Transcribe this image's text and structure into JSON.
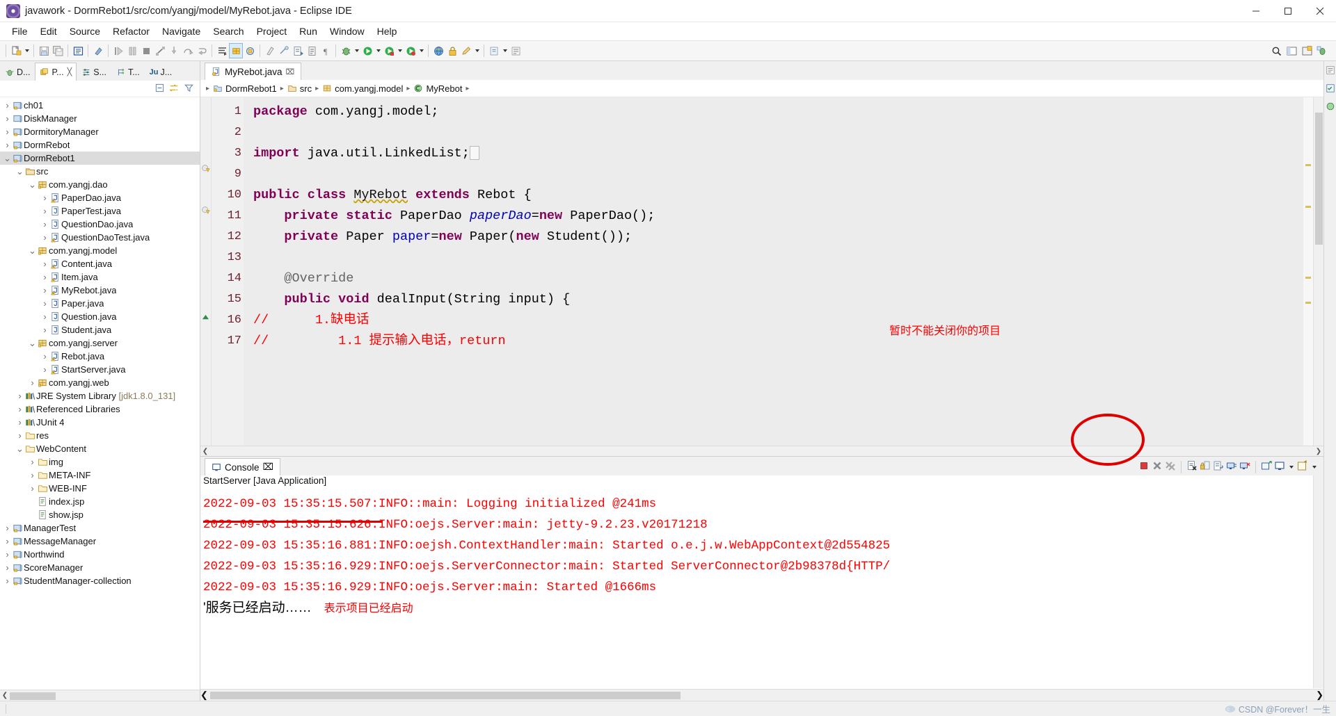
{
  "window": {
    "title": "javawork - DormRebot1/src/com/yangj/model/MyRebot.java - Eclipse IDE",
    "minimize": "─",
    "maximize": "☐",
    "close": "✕"
  },
  "menubar": [
    "File",
    "Edit",
    "Source",
    "Refactor",
    "Navigate",
    "Search",
    "Project",
    "Run",
    "Window",
    "Help"
  ],
  "explorer": {
    "tabs": [
      {
        "label": "D...",
        "active": false
      },
      {
        "label": "P...",
        "active": true
      },
      {
        "label": "S...",
        "active": false
      },
      {
        "label": "T...",
        "active": false
      },
      {
        "label": "J...",
        "active": false
      }
    ],
    "tree": [
      {
        "indent": 0,
        "arrow": "›",
        "icon": "project",
        "label": "ch01"
      },
      {
        "indent": 0,
        "arrow": "›",
        "icon": "project-plain",
        "label": "DiskManager"
      },
      {
        "indent": 0,
        "arrow": "›",
        "icon": "project",
        "label": "DormitoryManager"
      },
      {
        "indent": 0,
        "arrow": "›",
        "icon": "project",
        "label": "DormRebot"
      },
      {
        "indent": 0,
        "arrow": "⌄",
        "icon": "project",
        "label": "DormRebot1",
        "selected": true
      },
      {
        "indent": 1,
        "arrow": "⌄",
        "icon": "source-folder",
        "label": "src"
      },
      {
        "indent": 2,
        "arrow": "⌄",
        "icon": "package",
        "label": "com.yangj.dao"
      },
      {
        "indent": 3,
        "arrow": "›",
        "icon": "java-warn",
        "label": "PaperDao.java"
      },
      {
        "indent": 3,
        "arrow": "›",
        "icon": "java",
        "label": "PaperTest.java"
      },
      {
        "indent": 3,
        "arrow": "›",
        "icon": "java",
        "label": "QuestionDao.java"
      },
      {
        "indent": 3,
        "arrow": "›",
        "icon": "java-warn",
        "label": "QuestionDaoTest.java"
      },
      {
        "indent": 2,
        "arrow": "⌄",
        "icon": "package",
        "label": "com.yangj.model"
      },
      {
        "indent": 3,
        "arrow": "›",
        "icon": "java-warn",
        "label": "Content.java"
      },
      {
        "indent": 3,
        "arrow": "›",
        "icon": "java-warn",
        "label": "Item.java"
      },
      {
        "indent": 3,
        "arrow": "›",
        "icon": "java-warn",
        "label": "MyRebot.java"
      },
      {
        "indent": 3,
        "arrow": "›",
        "icon": "java",
        "label": "Paper.java"
      },
      {
        "indent": 3,
        "arrow": "›",
        "icon": "java",
        "label": "Question.java"
      },
      {
        "indent": 3,
        "arrow": "›",
        "icon": "java",
        "label": "Student.java"
      },
      {
        "indent": 2,
        "arrow": "⌄",
        "icon": "package",
        "label": "com.yangj.server"
      },
      {
        "indent": 3,
        "arrow": "›",
        "icon": "java-warn",
        "label": "Rebot.java"
      },
      {
        "indent": 3,
        "arrow": "›",
        "icon": "java-warn",
        "label": "StartServer.java"
      },
      {
        "indent": 2,
        "arrow": "›",
        "icon": "package",
        "label": "com.yangj.web"
      },
      {
        "indent": 1,
        "arrow": "›",
        "icon": "library",
        "label": "JRE System Library ",
        "dim": "[jdk1.8.0_131]"
      },
      {
        "indent": 1,
        "arrow": "›",
        "icon": "library",
        "label": "Referenced Libraries"
      },
      {
        "indent": 1,
        "arrow": "›",
        "icon": "library",
        "label": "JUnit 4"
      },
      {
        "indent": 1,
        "arrow": "›",
        "icon": "folder",
        "label": "res"
      },
      {
        "indent": 1,
        "arrow": "⌄",
        "icon": "folder",
        "label": "WebContent"
      },
      {
        "indent": 2,
        "arrow": "›",
        "icon": "folder",
        "label": "img"
      },
      {
        "indent": 2,
        "arrow": "›",
        "icon": "folder",
        "label": "META-INF"
      },
      {
        "indent": 2,
        "arrow": "›",
        "icon": "folder",
        "label": "WEB-INF"
      },
      {
        "indent": 2,
        "arrow": "",
        "icon": "jsp",
        "label": "index.jsp"
      },
      {
        "indent": 2,
        "arrow": "",
        "icon": "jsp",
        "label": "show.jsp"
      },
      {
        "indent": 0,
        "arrow": "›",
        "icon": "project",
        "label": "ManagerTest"
      },
      {
        "indent": 0,
        "arrow": "›",
        "icon": "project",
        "label": "MessageManager"
      },
      {
        "indent": 0,
        "arrow": "›",
        "icon": "project",
        "label": "Northwind"
      },
      {
        "indent": 0,
        "arrow": "›",
        "icon": "project",
        "label": "ScoreManager"
      },
      {
        "indent": 0,
        "arrow": "›",
        "icon": "project",
        "label": "StudentManager-collection"
      }
    ]
  },
  "editor": {
    "tab": {
      "label": "MyRebot.java",
      "close": "⌧"
    },
    "breadcrumb": [
      "DormRebot1",
      "src",
      "com.yangj.model",
      "MyRebot"
    ],
    "lines": [
      {
        "num": "1",
        "fold": "",
        "tokens": [
          {
            "t": "package ",
            "c": "k"
          },
          {
            "t": "com.yangj.model;",
            "c": "plain"
          }
        ]
      },
      {
        "num": "2",
        "fold": "",
        "tokens": []
      },
      {
        "num": "3",
        "fold": "⊕",
        "tokens": [
          {
            "t": "import ",
            "c": "k"
          },
          {
            "t": "java.util.LinkedList;",
            "c": "plain"
          },
          {
            "t": "⬚",
            "c": "collapsed"
          }
        ]
      },
      {
        "num": "9",
        "fold": "",
        "tokens": []
      },
      {
        "num": "10",
        "fold": "",
        "tokens": [
          {
            "t": "public class ",
            "c": "k"
          },
          {
            "t": "MyRebot",
            "c": "squiggle"
          },
          {
            "t": " ",
            "c": "plain"
          },
          {
            "t": "extends ",
            "c": "k"
          },
          {
            "t": "Rebot {",
            "c": "plain"
          }
        ]
      },
      {
        "num": "11",
        "fold": "",
        "tokens": [
          {
            "t": "    ",
            "c": "plain"
          },
          {
            "t": "private static ",
            "c": "k"
          },
          {
            "t": "PaperDao ",
            "c": "plain"
          },
          {
            "t": "paperDao",
            "c": "fld-i"
          },
          {
            "t": "=",
            "c": "plain"
          },
          {
            "t": "new ",
            "c": "k"
          },
          {
            "t": "PaperDao();",
            "c": "plain"
          }
        ]
      },
      {
        "num": "12",
        "fold": "",
        "tokens": [
          {
            "t": "    ",
            "c": "plain"
          },
          {
            "t": "private ",
            "c": "k"
          },
          {
            "t": "Paper ",
            "c": "plain"
          },
          {
            "t": "paper",
            "c": "fld"
          },
          {
            "t": "=",
            "c": "plain"
          },
          {
            "t": "new ",
            "c": "k"
          },
          {
            "t": "Paper(",
            "c": "plain"
          },
          {
            "t": "new ",
            "c": "k"
          },
          {
            "t": "Student());",
            "c": "plain"
          }
        ]
      },
      {
        "num": "13",
        "fold": "",
        "tokens": []
      },
      {
        "num": "14",
        "fold": "⊖",
        "tokens": [
          {
            "t": "    @Override",
            "c": "anno"
          }
        ]
      },
      {
        "num": "15",
        "fold": "",
        "tokens": [
          {
            "t": "    ",
            "c": "plain"
          },
          {
            "t": "public void ",
            "c": "k"
          },
          {
            "t": "dealInput(String input) {",
            "c": "plain"
          }
        ]
      },
      {
        "num": "16",
        "fold": "",
        "tokens": [
          {
            "t": "//      1.缺电话",
            "c": "cmt-red"
          }
        ]
      },
      {
        "num": "17",
        "fold": "",
        "tokens": [
          {
            "t": "//         1.1 提示输入电话，return",
            "c": "cmt-red"
          }
        ]
      }
    ],
    "note": "暂时不能关闭你的项目"
  },
  "console": {
    "tab": {
      "label": "Console",
      "close": "⌧"
    },
    "launch": "StartServer [Java Application]",
    "lines": [
      "2022-09-03 15:35:15.507:INFO::main: Logging initialized @241ms",
      "2022-09-03 15:35:15.626:INFO:oejs.Server:main: jetty-9.2.23.v20171218",
      "2022-09-03 15:35:16.881:INFO:oejsh.ContextHandler:main: Started o.e.j.w.WebAppContext@2d554825",
      "2022-09-03 15:35:16.929:INFO:oejs.ServerConnector:main: Started ServerConnector@2b98378d{HTTP/",
      "2022-09-03 15:35:16.929:INFO:oejs.Server:main: Started @1666ms"
    ],
    "chinese_line": "'服务已经启动……",
    "note": "表示项目已经启动",
    "tools": [
      "terminate-icon",
      "remove-launch-icon",
      "remove-all-launches-icon",
      "clear-console-icon",
      "scroll-lock-icon",
      "word-wrap-icon",
      "show-console-on-output-icon",
      "close-console-on-exit-icon",
      "pin-console-icon",
      "display-selected-console-icon",
      "open-console-icon"
    ]
  },
  "statusbar": {
    "watermark": "CSDN @Forever！一生"
  }
}
